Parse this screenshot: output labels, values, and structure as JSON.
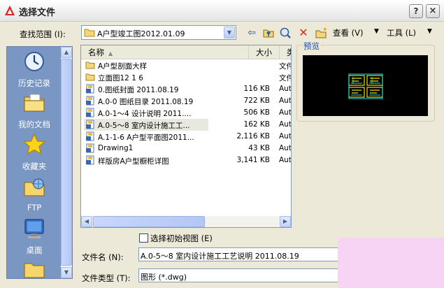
{
  "window": {
    "title": "选择文件",
    "help": "?",
    "close": "×"
  },
  "toolbar": {
    "look_in_label": "查找范围 (I):",
    "look_in_value": "A户型竣工图2012.01.09",
    "views_label": "查看 (V)",
    "tools_label": "工具 (L)"
  },
  "places": [
    {
      "label": "历史记录",
      "icon": "history-icon"
    },
    {
      "label": "我的文档",
      "icon": "my-documents-icon"
    },
    {
      "label": "收藏夹",
      "icon": "favorites-icon"
    },
    {
      "label": "FTP",
      "icon": "ftp-icon"
    },
    {
      "label": "桌面",
      "icon": "desktop-icon"
    }
  ],
  "file_list": {
    "columns": [
      "名称",
      "大小",
      "类型"
    ],
    "selected_index": 5,
    "rows": [
      {
        "name": "A户型剖面大样",
        "size": "",
        "type": "文件",
        "kind": "folder"
      },
      {
        "name": "立面图12 1 6",
        "size": "",
        "type": "文件",
        "kind": "folder"
      },
      {
        "name": "0.图纸封面 2011.08.19",
        "size": "116 KB",
        "type": "Aut",
        "kind": "dwg"
      },
      {
        "name": "A.0-0 图纸目录 2011.08.19",
        "size": "722 KB",
        "type": "Aut",
        "kind": "dwg"
      },
      {
        "name": "A.0-1～4 设计说明 2011....",
        "size": "506 KB",
        "type": "Aut",
        "kind": "dwg"
      },
      {
        "name": "A.0-5～8 室内设计施工工...",
        "size": "162 KB",
        "type": "Aut",
        "kind": "dwg"
      },
      {
        "name": "A.1-1-6 A户型平面图2011...",
        "size": "2,116 KB",
        "type": "Aut",
        "kind": "dwg"
      },
      {
        "name": "Drawing1",
        "size": "43 KB",
        "type": "Aut",
        "kind": "dwg"
      },
      {
        "name": "样版房A户型橱柜详图",
        "size": "3,141 KB",
        "type": "Aut",
        "kind": "dwg"
      }
    ]
  },
  "preview": {
    "label": "预览"
  },
  "options": {
    "initial_view_label": "选择初始视图 (E)",
    "initial_view_checked": false
  },
  "filename": {
    "label": "文件名 (N):",
    "value": "A.0-5～8 室内设计施工工艺说明 2011.08.19"
  },
  "filetype": {
    "label": "文件类型 (T):",
    "value": "图形 (*.dwg)"
  },
  "colors": {
    "places_bg": "#7a96c3",
    "dialog_bg": "#ece9d8",
    "preview_bg": "#000000",
    "cad_accent": "#f0e000"
  }
}
